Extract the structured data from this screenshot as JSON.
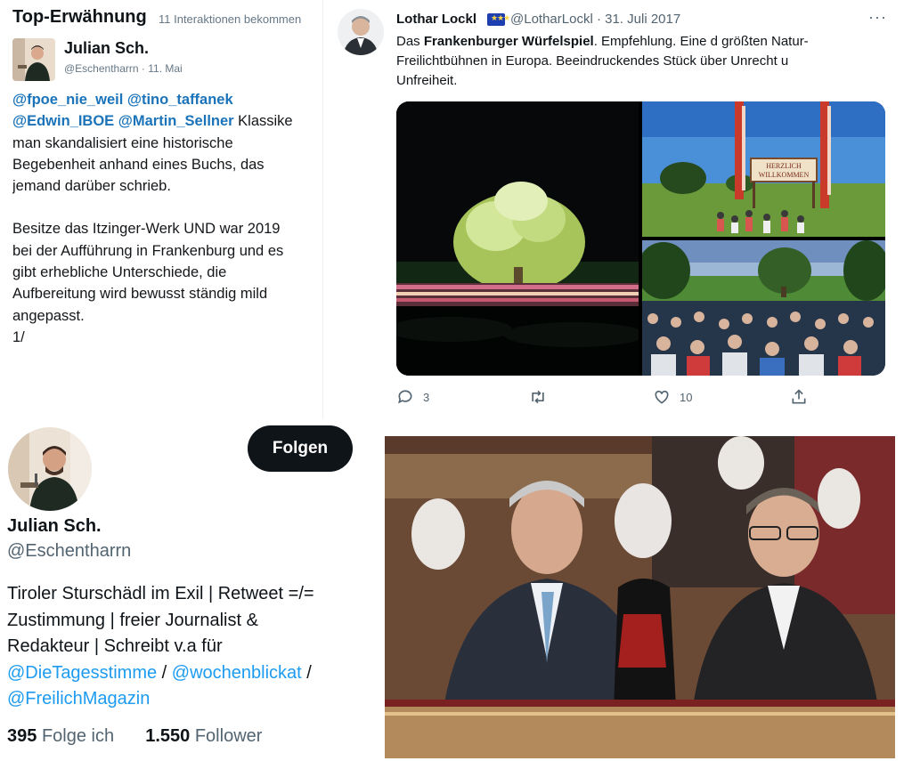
{
  "mention_panel": {
    "title": "Top-Erwähnung",
    "subtitle": "11 Interaktionen bekommen",
    "author_name": "Julian Sch.",
    "author_handle": "@Eschentharrn",
    "date": "11. Mai",
    "mentions_line1": [
      "@fpoe_nie_weil",
      "@tino_taffanek"
    ],
    "mentions_line2": [
      "@Edwin_IBOE",
      "@Martin_Sellner"
    ],
    "line2_tail": "Klassike",
    "body_lines": [
      "man skandalisiert eine historische",
      "Begebenheit anhand eines Buchs, das",
      "jemand darüber schrieb.",
      "",
      "Besitze das Itzinger-Werk UND war 2019",
      "bei der Aufführung in Frankenburg und es",
      "gibt erhebliche Unterschiede, die",
      "Aufbereitung wird bewusst ständig mild",
      "angepasst.",
      "1/"
    ]
  },
  "tweet": {
    "author_name": "Lothar Lockl",
    "author_handle": "@LotharLockl",
    "separator": "·",
    "date": "31. Juli 2017",
    "more": "···",
    "text_prefix": "Das ",
    "text_bold": "Frankenburger Würfelspiel",
    "text_line1_rest": ". Empfehlung. Eine d größten Natur-",
    "text_line2": "Freilichtbühnen in Europa. Beeindruckendes Stück über Unrecht u",
    "text_line3": "Unfreiheit.",
    "sign_line1": "HERZLICH",
    "sign_line2": "WILLKOMMEN",
    "replies": "3",
    "likes": "10",
    "icons": [
      "reply-icon",
      "retweet-icon",
      "like-icon",
      "share-icon"
    ]
  },
  "profile": {
    "follow_label": "Folgen",
    "name": "Julian Sch.",
    "handle": "@Eschentharrn",
    "bio_line1": "Tiroler Sturschädl im Exil | Retweet =/=",
    "bio_line2": "Zustimmung | freier Journalist &",
    "bio_line3": "Redakteur | Schreibt v.a für",
    "bio_link1": "@DieTagesstimme",
    "bio_sep": " / ",
    "bio_link2": "@wochenblickat",
    "bio_sep2": " /",
    "bio_link3": "@FreilichMagazin",
    "following_count": "395",
    "following_label": "Folge ich",
    "followers_count": "1.550",
    "followers_label": "Follower"
  },
  "colors": {
    "accent": "#1d9bf0",
    "mention_link": "#1b73b9",
    "text": "#0f1419",
    "muted": "#536471",
    "button_bg": "#0f1419"
  }
}
